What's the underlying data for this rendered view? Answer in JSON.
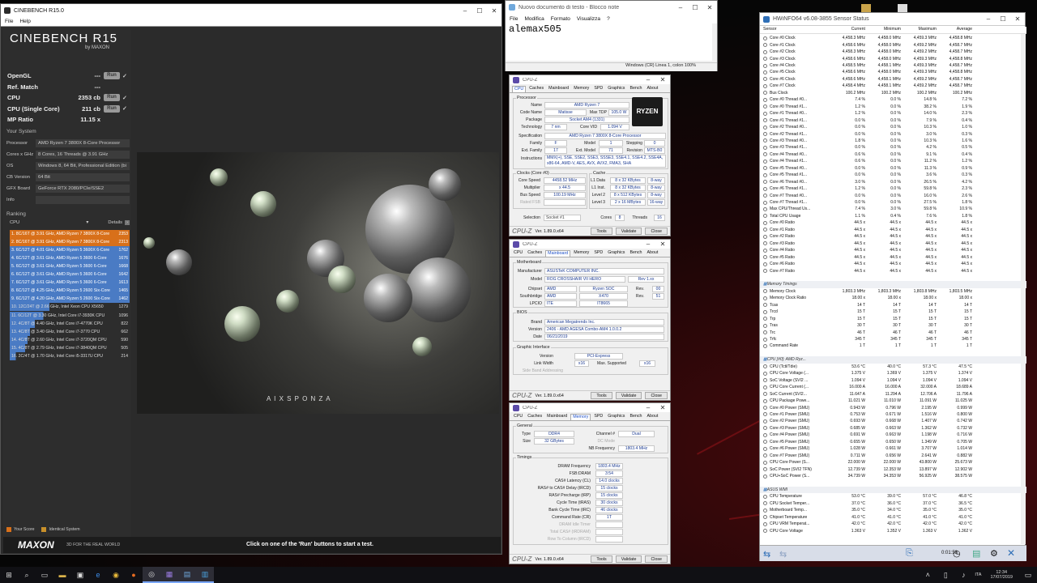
{
  "colors": {
    "desktop": "#060606",
    "accent_red": "#6b0e12",
    "cb_orange": "#d8701a",
    "cb_blue": "#4a7bc4",
    "cpuz_value": "#1d3c93"
  },
  "desktop": {
    "icons": [
      "recycle-bin-icon",
      "folder-icon"
    ]
  },
  "cinebench": {
    "title": "CINEBENCH R15.0",
    "menu": [
      "File",
      "Help"
    ],
    "logo_title": "CINEBENCH R15",
    "logo_by": "by MAXON",
    "scores": [
      {
        "label": "OpenGL",
        "value": "---",
        "run": "Run"
      },
      {
        "label": "Ref. Match",
        "value": "---",
        "run": ""
      },
      {
        "label": "CPU",
        "value": "2353 cb",
        "run": "Run"
      },
      {
        "label": "CPU (Single Core)",
        "value": "211 cb",
        "run": "Run"
      },
      {
        "label": "MP Ratio",
        "value": "11.15 x",
        "run": ""
      }
    ],
    "system_title": "Your System",
    "system": [
      {
        "k": "Processor",
        "v": "AMD Ryzen 7 3800X 8-Core Processor"
      },
      {
        "k": "Cores x GHz",
        "v": "8 Cores, 16 Threads @ 3.91 GHz"
      },
      {
        "k": "OS",
        "v": "Windows 8, 64 Bit, Professional Edition (bi"
      },
      {
        "k": "CB Version",
        "v": "64 Bit"
      },
      {
        "k": "GFX Board",
        "v": "GeForce RTX 2080/PCIe/SSE2"
      },
      {
        "k": "Info",
        "v": ""
      }
    ],
    "ranking_title": "Ranking",
    "ranking_select": "CPU",
    "details_label": "Details",
    "ranking": [
      {
        "n": "1. 8C/16T @ 3.91 GHz, AMD Ryzen 7 3800X 8-Core",
        "s": "2353",
        "t": "you"
      },
      {
        "n": "2. 8C/16T @ 3.91 GHz, AMD Ryzen 7 3800X 8-Core",
        "s": "2313",
        "t": "you"
      },
      {
        "n": "3. 6C/12T @ 4.01 GHz, AMD Ryzen 5 3600X 6-Core",
        "s": "1762",
        "t": "id"
      },
      {
        "n": "4. 6C/12T @ 3.61 GHz, AMD Ryzen 5 3600 6-Core",
        "s": "1676",
        "t": "id"
      },
      {
        "n": "5. 6C/12T @ 3.61 GHz, AMD Ryzen 5 3600 6-Core",
        "s": "1668",
        "t": "id"
      },
      {
        "n": "6. 6C/12T @ 3.61 GHz, AMD Ryzen 5 3600 6-Core",
        "s": "1642",
        "t": "id"
      },
      {
        "n": "7. 6C/12T @ 3.61 GHz, AMD Ryzen 5 3600 6-Core",
        "s": "1613",
        "t": "id"
      },
      {
        "n": "8. 6C/12T @ 4.25 GHz, AMD Ryzen 5 2600 Six-Core",
        "s": "1465",
        "t": "id"
      },
      {
        "n": "9. 6C/12T @ 4.20 GHz, AMD Ryzen 5 2600 Six-Core",
        "s": "1462",
        "t": "id"
      },
      {
        "n": "10. 12C/24T @ 2.66 GHz, Intel Xeon CPU X5650",
        "s": "1279",
        "t": "part"
      },
      {
        "n": "11. 6C/12T @ 3.30 GHz, Intel Core i7-3930K CPU",
        "s": "1096",
        "t": "part"
      },
      {
        "n": "12. 4C/8T @ 4.40 GHz, Intel Core i7-4770K CPU",
        "s": "822",
        "t": "part"
      },
      {
        "n": "13. 4C/8T @ 3.40 GHz, Intel Core i7-3770 CPU",
        "s": "662",
        "t": "part"
      },
      {
        "n": "14. 4C/8T @ 2.60 GHz, Intel Core i7-3720QM CPU",
        "s": "590",
        "t": "part"
      },
      {
        "n": "15. 4C/8T @ 2.79 GHz, Intel Core i7-3840QM CPU",
        "s": "505",
        "t": "part"
      },
      {
        "n": "16. 2C/4T @ 1.70 GHz, Intel Core i5-3317U CPU",
        "s": "214",
        "t": "part"
      }
    ],
    "legend_your": "Your Score",
    "legend_identical": "Identical System",
    "footer_brand": "MAXON",
    "footer_tag": "3D FOR THE REAL WORLD",
    "footer_hint": "Click on one of the 'Run' buttons to start a test.",
    "art_brand": "A I X S P O N Z A"
  },
  "notepad": {
    "title": "Nuovo documento di testo - Blocco note",
    "menu": [
      "File",
      "Modifica",
      "Formato",
      "Visualizza",
      "?"
    ],
    "text": "alemax505",
    "status": "Windows (CR)     Linea 1, colon 100%"
  },
  "cpuz": {
    "title": "CPU-Z",
    "tabs": [
      "CPU",
      "Caches",
      "Mainboard",
      "Memory",
      "SPD",
      "Graphics",
      "Bench",
      "About"
    ],
    "version": "Ver. 1.89.0.x64",
    "tools": "Tools",
    "validate": "Validate",
    "close": "Close",
    "logo": "CPU-Z",
    "cpu": {
      "g_processor": "Processor",
      "name": "AMD Ryzen 7",
      "codename": "Matisse",
      "maxtdp": "105.0 W",
      "package": "Socket AM4 (1331)",
      "technology": "7 nm",
      "corevid": "1.094 V",
      "spec": "AMD Ryzen 7 3800X 8-Core Processor",
      "family": "F",
      "model": "1",
      "stepping": "0",
      "extfamily": "17",
      "extmodel": "71",
      "revision": "MTS-B0",
      "instructions": "MMX(+), SSE, SSE2, SSE3, SSSE3, SSE4.1, SSE4.2, SSE4A, x86-64, AMD-V, AES, AVX, AVX2, FMA3, SHA",
      "g_clocks": "Clocks (Core #0)",
      "corespeed": "4458.52 MHz",
      "multiplier": "x 44.5",
      "busspeed": "100.19 MHz",
      "ratedfsb": "",
      "g_cache": "Cache",
      "l1d": "8 x 32 KBytes",
      "l1d_w": "8-way",
      "l1i": "8 x 32 KBytes",
      "l1i_w": "8-way",
      "l2": "8 x 512 KBytes",
      "l2_w": "8-way",
      "l3": "2 x 16 MBytes",
      "l3_w": "16-way",
      "selection": "Socket #1",
      "cores": "8",
      "threads": "16",
      "logo": "RYZEN"
    },
    "mb": {
      "g_mb": "Motherboard",
      "manufacturer": "ASUSTeK COMPUTER INC.",
      "model": "ROG CROSSHAIR VII HERO",
      "rev": "Rev 1.xx",
      "chipset_v": "AMD",
      "chipset_n": "Ryzen SOC",
      "chipset_r": "00",
      "south_v": "AMD",
      "south_n": "X470",
      "south_r": "51",
      "lpcio_v": "ITE",
      "lpcio_n": "IT8665",
      "g_bios": "BIOS",
      "brand": "American Megatrends Inc.",
      "version": "2406 - AMD AGESA Combo-AM4 1.0.0.2",
      "date": "06/21/2019",
      "g_gfx": "Graphic Interface",
      "gi_version": "PCI-Express",
      "linkwidth": "x16",
      "maxsupported": "x16"
    },
    "mem": {
      "g_general": "General",
      "type": "DDR4",
      "size": "32 GBytes",
      "channel": "Dual",
      "dcmode": "",
      "nbfreq": "1803.4 MHz",
      "g_timings": "Timings",
      "dram": "1803.4 MHz",
      "fsbdram": "3:54",
      "cl": "14.0 clocks",
      "trcd": "15 clocks",
      "trp": "15 clocks",
      "tras": "30 clocks",
      "trc": "46 clocks",
      "cr": "1T"
    },
    "labels": {
      "name": "Name",
      "codename": "Code Name",
      "maxtdp": "Max TDP",
      "package": "Package",
      "technology": "Technology",
      "corevid": "Core VID",
      "spec": "Specification",
      "family": "Family",
      "model": "Model",
      "stepping": "Stepping",
      "extfamily": "Ext. Family",
      "extmodel": "Ext. Model",
      "revision": "Revision",
      "instructions": "Instructions",
      "corespeed": "Core Speed",
      "multiplier": "Multiplier",
      "busspeed": "Bus Speed",
      "ratedfsb": "Rated FSB",
      "l1d": "L1 Data",
      "l1i": "L1 Inst.",
      "l2": "Level 2",
      "l3": "Level 3",
      "selection": "Selection",
      "cores": "Cores",
      "threads": "Threads",
      "manufacturer": "Manufacturer",
      "mbmodel": "Model",
      "chipset": "Chipset",
      "south": "Southbridge",
      "lpcio": "LPCIO",
      "rev": "Rev.",
      "brand": "Brand",
      "version": "Version",
      "date": "Date",
      "gi_version": "Version",
      "linkwidth": "Link Width",
      "maxsupported": "Max. Supported",
      "sideband": "Side Band Addressing",
      "type": "Type",
      "size": "Size",
      "channel": "Channel #",
      "dcmode": "DC Mode",
      "nbfreq": "NB Frequency",
      "dram": "DRAM Frequency",
      "fsbdram": "FSB:DRAM",
      "cl": "CAS# Latency (CL)",
      "trcd": "RAS# to CAS# Delay (tRCD)",
      "trp": "RAS# Precharge (tRP)",
      "tras": "Cycle Time (tRAS)",
      "trc": "Bank Cycle Time (tRC)",
      "cr": "Command Rate (CR)",
      "idle": "DRAM Idle Timer",
      "totalcas": "Total CAS# (tRDRAM)",
      "rtc": "Row To Column (tRCD)"
    }
  },
  "hwinfo": {
    "title": "HWiNFO64 v6.08-3855 Sensor Status",
    "headers": [
      "Sensor",
      "Current",
      "Minimum",
      "Maximum",
      "Average"
    ],
    "rows": [
      [
        "Core #0 Clock",
        "4,458.3 MHz",
        "4,458.0 MHz",
        "4,459.3 MHz",
        "4,458.8 MHz"
      ],
      [
        "Core #1 Clock",
        "4,458.6 MHz",
        "4,458.0 MHz",
        "4,459.2 MHz",
        "4,458.7 MHz"
      ],
      [
        "Core #2 Clock",
        "4,458.3 MHz",
        "4,458.0 MHz",
        "4,459.2 MHz",
        "4,458.7 MHz"
      ],
      [
        "Core #3 Clock",
        "4,458.6 MHz",
        "4,458.0 MHz",
        "4,459.3 MHz",
        "4,458.8 MHz"
      ],
      [
        "Core #4 Clock",
        "4,458.5 MHz",
        "4,458.1 MHz",
        "4,459.3 MHz",
        "4,458.7 MHz"
      ],
      [
        "Core #5 Clock",
        "4,458.6 MHz",
        "4,458.0 MHz",
        "4,459.3 MHz",
        "4,458.8 MHz"
      ],
      [
        "Core #6 Clock",
        "4,458.6 MHz",
        "4,458.1 MHz",
        "4,459.2 MHz",
        "4,458.7 MHz"
      ],
      [
        "Core #7 Clock",
        "4,458.4 MHz",
        "4,458.1 MHz",
        "4,459.2 MHz",
        "4,458.7 MHz"
      ],
      [
        "Bus Clock",
        "100.2 MHz",
        "100.2 MHz",
        "100.2 MHz",
        "100.2 MHz"
      ],
      [
        "Core #0 Thread #0...",
        "7.4 %",
        "0.0 %",
        "14.8 %",
        "7.2 %"
      ],
      [
        "Core #0 Thread #1...",
        "1.2 %",
        "0.0 %",
        "38.2 %",
        "1.9 %"
      ],
      [
        "Core #1 Thread #0...",
        "1.2 %",
        "0.0 %",
        "14.0 %",
        "2.3 %"
      ],
      [
        "Core #1 Thread #1...",
        "0.0 %",
        "0.0 %",
        "7.9 %",
        "0.4 %"
      ],
      [
        "Core #2 Thread #0...",
        "0.0 %",
        "0.0 %",
        "10.3 %",
        "1.0 %"
      ],
      [
        "Core #2 Thread #1...",
        "0.0 %",
        "0.0 %",
        "3.0 %",
        "0.3 %"
      ],
      [
        "Core #3 Thread #0...",
        "1.8 %",
        "0.0 %",
        "10.3 %",
        "1.6 %"
      ],
      [
        "Core #3 Thread #1...",
        "0.0 %",
        "0.0 %",
        "4.2 %",
        "0.5 %"
      ],
      [
        "Core #4 Thread #0...",
        "0.6 %",
        "0.0 %",
        "9.1 %",
        "0.4 %"
      ],
      [
        "Core #4 Thread #1...",
        "0.6 %",
        "0.0 %",
        "11.2 %",
        "1.2 %"
      ],
      [
        "Core #5 Thread #0...",
        "0.0 %",
        "0.0 %",
        "11.3 %",
        "0.9 %"
      ],
      [
        "Core #5 Thread #1...",
        "0.0 %",
        "0.0 %",
        "3.6 %",
        "0.3 %"
      ],
      [
        "Core #6 Thread #0...",
        "3.0 %",
        "0.0 %",
        "26.5 %",
        "4.2 %"
      ],
      [
        "Core #6 Thread #1...",
        "1.2 %",
        "0.0 %",
        "59.8 %",
        "2.3 %"
      ],
      [
        "Core #7 Thread #0...",
        "0.0 %",
        "0.0 %",
        "16.0 %",
        "2.6 %"
      ],
      [
        "Core #7 Thread #1...",
        "0.0 %",
        "0.0 %",
        "27.5 %",
        "1.8 %"
      ],
      [
        "Max CPU/Thread Us...",
        "7.4 %",
        "3.0 %",
        "59.8 %",
        "10.9 %"
      ],
      [
        "Total CPU Usage",
        "1.1 %",
        "0.4 %",
        "7.6 %",
        "1.8 %"
      ],
      [
        "Core #0 Ratio",
        "44.5 x",
        "44.5 x",
        "44.5 x",
        "44.5 x"
      ],
      [
        "Core #1 Ratio",
        "44.5 x",
        "44.5 x",
        "44.5 x",
        "44.5 x"
      ],
      [
        "Core #2 Ratio",
        "44.5 x",
        "44.5 x",
        "44.5 x",
        "44.5 x"
      ],
      [
        "Core #3 Ratio",
        "44.5 x",
        "44.5 x",
        "44.5 x",
        "44.5 x"
      ],
      [
        "Core #4 Ratio",
        "44.5 x",
        "44.5 x",
        "44.5 x",
        "44.5 x"
      ],
      [
        "Core #5 Ratio",
        "44.5 x",
        "44.5 x",
        "44.5 x",
        "44.5 x"
      ],
      [
        "Core #6 Ratio",
        "44.5 x",
        "44.5 x",
        "44.5 x",
        "44.5 x"
      ],
      [
        "Core #7 Ratio",
        "44.5 x",
        "44.5 x",
        "44.5 x",
        "44.5 x"
      ],
      [
        "",
        "",
        "",
        "",
        ""
      ],
      [
        "Memory Timings",
        "",
        "",
        "",
        ""
      ],
      [
        "Memory Clock",
        "1,803.3 MHz",
        "1,803.3 MHz",
        "1,803.8 MHz",
        "1,803.5 MHz"
      ],
      [
        "Memory Clock Ratio",
        "18.00 x",
        "18.00 x",
        "18.00 x",
        "18.00 x"
      ],
      [
        "Tcas",
        "14 T",
        "14 T",
        "14 T",
        "14 T"
      ],
      [
        "Trcd",
        "15 T",
        "15 T",
        "15 T",
        "15 T"
      ],
      [
        "Trp",
        "15 T",
        "15 T",
        "15 T",
        "15 T"
      ],
      [
        "Tras",
        "30 T",
        "30 T",
        "30 T",
        "30 T"
      ],
      [
        "Trc",
        "46 T",
        "46 T",
        "46 T",
        "46 T"
      ],
      [
        "Trfc",
        "345 T",
        "345 T",
        "345 T",
        "345 T"
      ],
      [
        "Command Rate",
        "1 T",
        "1 T",
        "1 T",
        "1 T"
      ],
      [
        "",
        "",
        "",
        "",
        ""
      ],
      [
        "CPU [#0]: AMD Ryz...",
        "",
        "",
        "",
        ""
      ],
      [
        "CPU (Tctl/Tdie)",
        "53.6 °C",
        "40.0 °C",
        "57.3 °C",
        "47.5 °C"
      ],
      [
        "CPU Core Voltage (...",
        "1.375 V",
        "1.369 V",
        "1.375 V",
        "1.374 V"
      ],
      [
        "SoC Voltage (SVI2 ...",
        "1.094 V",
        "1.094 V",
        "1.094 V",
        "1.094 V"
      ],
      [
        "CPU Core Current (...",
        "16.000 A",
        "16.000 A",
        "32.000 A",
        "18.689 A"
      ],
      [
        "SoC Current (SVI2...",
        "11.647 A",
        "11.294 A",
        "12.706 A",
        "11.796 A"
      ],
      [
        "CPU Package Powe...",
        "11.021 W",
        "11.010 W",
        "11.091 W",
        "11.025 W"
      ],
      [
        "Core #0 Power (SMU)",
        "0.943 W",
        "0.796 W",
        "2.195 W",
        "0.999 W"
      ],
      [
        "Core #1 Power (SMU)",
        "0.753 W",
        "0.671 W",
        "1.516 W",
        "0.800 W"
      ],
      [
        "Core #2 Power (SMU)",
        "0.693 W",
        "0.668 W",
        "1.407 W",
        "0.742 W"
      ],
      [
        "Core #3 Power (SMU)",
        "0.685 W",
        "0.663 W",
        "1.362 W",
        "0.732 W"
      ],
      [
        "Core #4 Power (SMU)",
        "0.691 W",
        "0.663 W",
        "1.198 W",
        "0.716 W"
      ],
      [
        "Core #5 Power (SMU)",
        "0.655 W",
        "0.650 W",
        "1.349 W",
        "0.705 W"
      ],
      [
        "Core #6 Power (SMU)",
        "1.028 W",
        "0.661 W",
        "3.707 W",
        "1.014 W"
      ],
      [
        "Core #7 Power (SMU)",
        "0.711 W",
        "0.656 W",
        "2.641 W",
        "0.882 W"
      ],
      [
        "CPU Core Power (S...",
        "22.000 W",
        "22.000 W",
        "43.800 W",
        "25.673 W"
      ],
      [
        "SoC Power (SVI2 TFN)",
        "12.739 W",
        "12.353 W",
        "13.897 W",
        "12.902 W"
      ],
      [
        "CPU+SoC Power (S...",
        "34.739 W",
        "34.353 W",
        "56.925 W",
        "38.575 W"
      ],
      [
        "",
        "",
        "",
        "",
        ""
      ],
      [
        "ASUS WMI",
        "",
        "",
        "",
        ""
      ],
      [
        "CPU Temperature",
        "53.0 °C",
        "39.0 °C",
        "57.0 °C",
        "46.8 °C"
      ],
      [
        "CPU Socket Temper...",
        "37.0 °C",
        "36.0 °C",
        "37.0 °C",
        "36.5 °C"
      ],
      [
        "Motherboard Temp...",
        "35.0 °C",
        "34.0 °C",
        "35.0 °C",
        "35.0 °C"
      ],
      [
        "Chipset Temperature",
        "41.0 °C",
        "41.0 °C",
        "41.0 °C",
        "41.0 °C"
      ],
      [
        "CPU VRM Temperat...",
        "42.0 °C",
        "42.0 °C",
        "42.0 °C",
        "42.0 °C"
      ],
      [
        "CPU Core Voltage",
        "1.363 V",
        "1.352 V",
        "1.363 V",
        "1.362 V"
      ]
    ],
    "sections": [
      "Memory Timings",
      "CPU [#0]: AMD Ryz...",
      "ASUS WMI"
    ],
    "timer": "0:01:58"
  },
  "taskbar": {
    "time": "12:34",
    "date": "17/07/2019",
    "lang": "ITA"
  }
}
